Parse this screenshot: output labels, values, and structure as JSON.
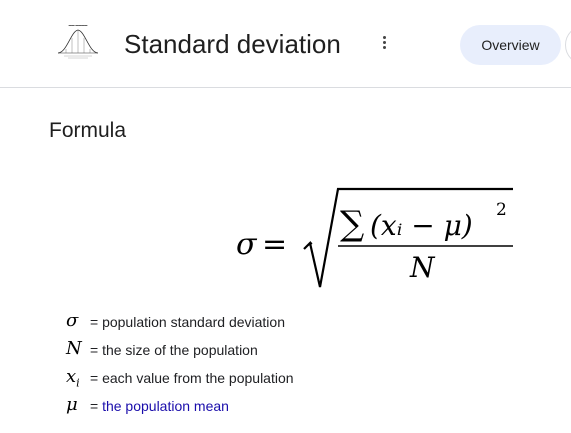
{
  "header": {
    "title": "Standard deviation",
    "tabs": [
      {
        "label": "Overview",
        "active": true
      }
    ]
  },
  "section": {
    "title": "Formula"
  },
  "formula": {
    "lhs": "σ",
    "equals": "=",
    "numerator_sum": "∑",
    "numerator_body": "(xᵢ − μ)",
    "exponent": "2",
    "denominator": "N"
  },
  "definitions": [
    {
      "symbol": "σ",
      "prefix": "= ",
      "text": "population standard deviation",
      "is_link": false
    },
    {
      "symbol": "N",
      "prefix": "= ",
      "text": "the size of the population",
      "is_link": false
    },
    {
      "symbol": "x",
      "symbol_sub": "i",
      "prefix": "= ",
      "text": "each value from the population",
      "is_link": false
    },
    {
      "symbol": "μ",
      "prefix": "= ",
      "text": "the population mean",
      "is_link": true
    }
  ],
  "colors": {
    "link": "#1a0dab",
    "tab_active_bg": "#e8eefc",
    "divider": "#dadce0"
  }
}
